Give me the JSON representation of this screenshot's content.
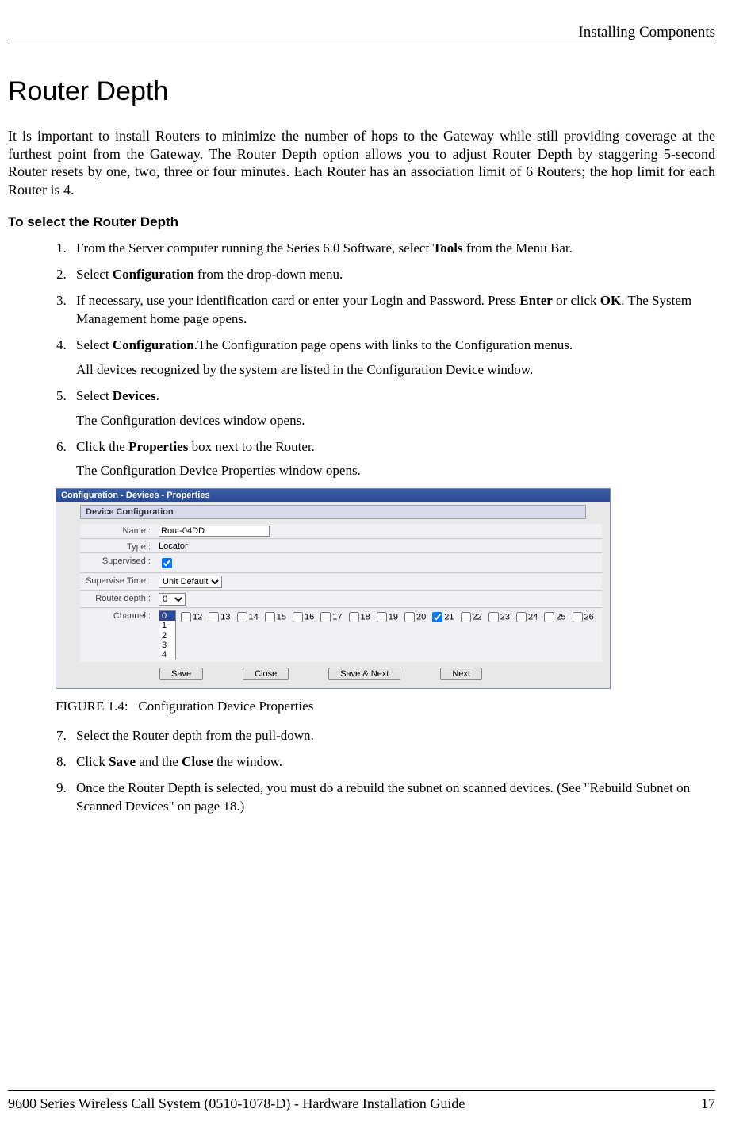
{
  "header": {
    "section": "Installing Components"
  },
  "title": "Router Depth",
  "intro": "It is important to install Routers to minimize the number of hops to the Gateway while still providing coverage at the furthest point from the Gateway. The Router Depth option allows you to adjust Router Depth by staggering 5-second Router resets by one, two, three or four minutes. Each Router has an association limit of 6 Routers; the hop limit for each Router is 4.",
  "subhead": "To select the Router Depth",
  "steps": {
    "s1_a": "From the Server computer running the Series 6.0 Software, select ",
    "s1_b": "Tools",
    "s1_c": " from the Menu Bar.",
    "s2_a": "Select ",
    "s2_b": "Configuration",
    "s2_c": " from the drop-down menu.",
    "s3_a": "If necessary, use your identification card or enter your Login and Password. Press ",
    "s3_b": "Enter",
    "s3_c": " or click ",
    "s3_d": "OK",
    "s3_e": ". The System Management home page opens.",
    "s4_a": "Select ",
    "s4_b": "Configuration",
    "s4_c": ".The Configuration page opens with links to the Configuration menus.",
    "s4_p": "All devices recognized by the system are listed in the Configuration Device window.",
    "s5_a": "Select ",
    "s5_b": "Devices",
    "s5_c": ".",
    "s5_p": "The Configuration devices window opens.",
    "s6_a": "Click the ",
    "s6_b": "Properties",
    "s6_c": " box next to the Router.",
    "s6_p": "The Configuration Device Properties window opens.",
    "s7": "Select the Router depth from the pull-down.",
    "s8_a": "Click ",
    "s8_b": "Save",
    "s8_c": " and the ",
    "s8_d": "Close",
    "s8_e": " the window.",
    "s9": "Once the Router Depth is selected, you must do a rebuild the subnet on scanned devices. (See \"Rebuild Subnet on Scanned Devices\" on page 18.)"
  },
  "dialog": {
    "title": "Configuration - Devices - Properties",
    "subtitle": "Device Configuration",
    "labels": {
      "name": "Name :",
      "type": "Type :",
      "supervised": "Supervised :",
      "supervise_time": "Supervise Time :",
      "router_depth": "Router depth :",
      "channel": "Channel :"
    },
    "values": {
      "name": "Rout-04DD",
      "type": "Locator",
      "supervise_time": "Unit Default",
      "router_depth_selected": "0",
      "router_depth_options": [
        "0",
        "1",
        "2",
        "3",
        "4"
      ]
    },
    "channels": [
      {
        "n": "12",
        "c": false
      },
      {
        "n": "13",
        "c": false
      },
      {
        "n": "14",
        "c": false
      },
      {
        "n": "15",
        "c": false
      },
      {
        "n": "16",
        "c": false
      },
      {
        "n": "17",
        "c": false
      },
      {
        "n": "18",
        "c": false
      },
      {
        "n": "19",
        "c": false
      },
      {
        "n": "20",
        "c": false
      },
      {
        "n": "21",
        "c": true
      },
      {
        "n": "22",
        "c": false
      },
      {
        "n": "23",
        "c": false
      },
      {
        "n": "24",
        "c": false
      },
      {
        "n": "25",
        "c": false
      },
      {
        "n": "26",
        "c": false
      }
    ],
    "buttons": {
      "save": "Save",
      "close": "Close",
      "save_next": "Save & Next",
      "next": "Next"
    }
  },
  "figure": {
    "label": "FIGURE 1.4:",
    "caption": "Configuration Device Properties"
  },
  "footer": {
    "doc": "9600 Series Wireless Call System (0510-1078-D) - Hardware Installation Guide",
    "page": "17"
  }
}
